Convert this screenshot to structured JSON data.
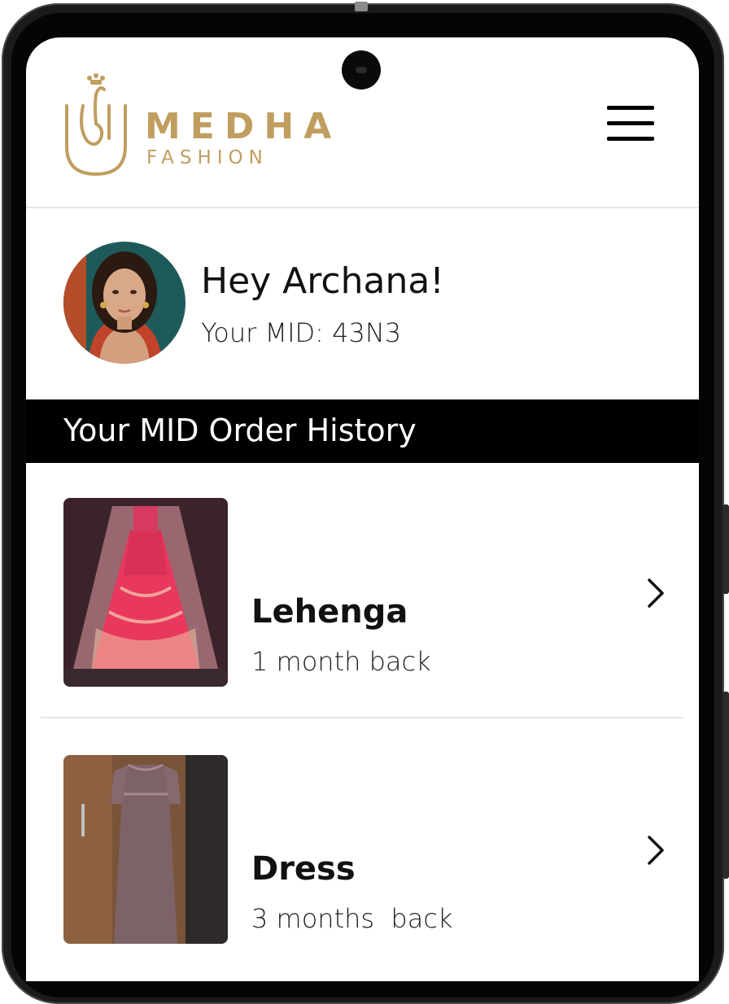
{
  "brand": {
    "name": "MEDHA",
    "tagline": "FASHION",
    "color": "#bf9e5f"
  },
  "header": {
    "menu_icon": "hamburger-menu-icon"
  },
  "profile": {
    "greeting": "Hey Archana!",
    "mid_text": "Your MID: 43N3"
  },
  "section": {
    "title": "Your MID Order History"
  },
  "orders": [
    {
      "name": "Lehenga",
      "time": "1 month back",
      "icon": "chevron-right-icon"
    },
    {
      "name": "Dress",
      "time": "3 months  back",
      "icon": "chevron-right-icon"
    }
  ]
}
